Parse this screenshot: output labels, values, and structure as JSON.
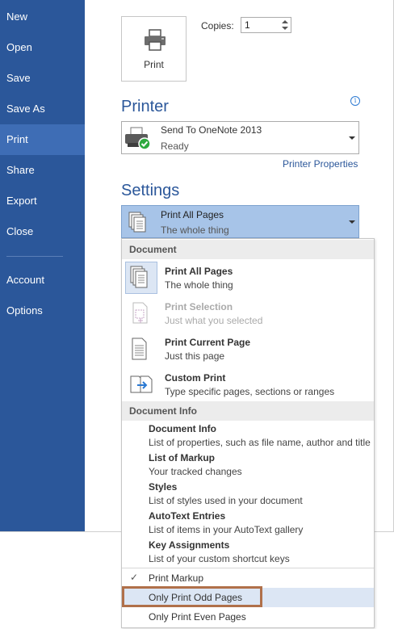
{
  "sidebar": {
    "items": [
      {
        "label": "New"
      },
      {
        "label": "Open"
      },
      {
        "label": "Save"
      },
      {
        "label": "Save As"
      },
      {
        "label": "Print",
        "active": true
      },
      {
        "label": "Share"
      },
      {
        "label": "Export"
      },
      {
        "label": "Close"
      },
      {
        "label": "Account"
      },
      {
        "label": "Options"
      }
    ]
  },
  "print": {
    "button_label": "Print",
    "copies_label": "Copies:",
    "copies_value": "1"
  },
  "printer": {
    "heading": "Printer",
    "name": "Send To OneNote 2013",
    "status": "Ready",
    "properties_link": "Printer Properties"
  },
  "settings": {
    "heading": "Settings",
    "selected_title": "Print All Pages",
    "selected_desc": "The whole thing"
  },
  "menu": {
    "document_header": "Document",
    "document_items": [
      {
        "title": "Print All Pages",
        "desc": "The whole thing",
        "icon": "all-pages-icon",
        "state": "selected"
      },
      {
        "title": "Print Selection",
        "desc": "Just what you selected",
        "icon": "selection-icon",
        "state": "disabled"
      },
      {
        "title": "Print Current Page",
        "desc": "Just this page",
        "icon": "page-icon",
        "state": "normal"
      },
      {
        "title": "Custom Print",
        "desc": "Type specific pages, sections or ranges",
        "icon": "custom-print-icon",
        "state": "normal"
      }
    ],
    "info_header": "Document Info",
    "info_items": [
      {
        "title": "Document Info",
        "desc": "List of properties, such as file name, author and title"
      },
      {
        "title": "List of Markup",
        "desc": "Your tracked changes"
      },
      {
        "title": "Styles",
        "desc": "List of styles used in your document"
      },
      {
        "title": "AutoText Entries",
        "desc": "List of items in your AutoText gallery"
      },
      {
        "title": "Key Assignments",
        "desc": "List of your custom shortcut keys"
      }
    ],
    "options": [
      {
        "label": "Print Markup",
        "checked": true
      },
      {
        "label": "Only Print Odd Pages",
        "highlighted": true
      },
      {
        "label": "Only Print Even Pages"
      }
    ]
  },
  "colors": {
    "sidebar_bg": "#2b579a",
    "sidebar_active": "#3e6db5",
    "heading": "#2b579a",
    "selected_bg": "#a7c4e8",
    "highlight_bg": "#dce6f4",
    "callout_border": "#b0704a"
  }
}
